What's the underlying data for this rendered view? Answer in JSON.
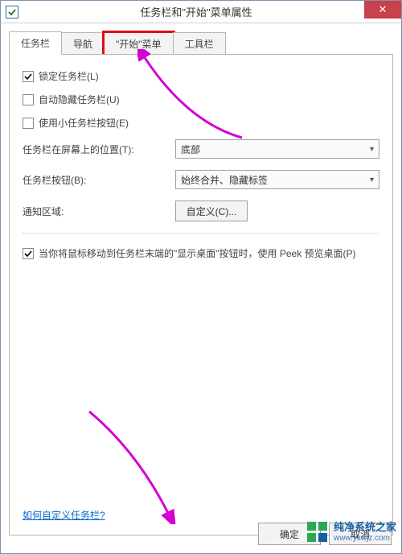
{
  "title": "任务栏和\"开始\"菜单属性",
  "tabs": [
    {
      "label": "任务栏",
      "active": true
    },
    {
      "label": "导航",
      "active": false
    },
    {
      "label": "\"开始\"菜单",
      "active": false,
      "highlight": true
    },
    {
      "label": "工具栏",
      "active": false
    }
  ],
  "checkboxes": {
    "lock": {
      "label": "锁定任务栏(L)",
      "checked": true
    },
    "autohide": {
      "label": "自动隐藏任务栏(U)",
      "checked": false
    },
    "smallbtn": {
      "label": "使用小任务栏按钮(E)",
      "checked": false
    }
  },
  "position": {
    "label": "任务栏在屏幕上的位置(T):",
    "value": "底部"
  },
  "buttons_combine": {
    "label": "任务栏按钮(B):",
    "value": "始终合并、隐藏标签"
  },
  "notify": {
    "label": "通知区域:",
    "button": "自定义(C)..."
  },
  "peek": {
    "checked": true,
    "label": "当你将鼠标移动到任务栏末端的\"显示桌面\"按钮时，使用 Peek 预览桌面(P)"
  },
  "help_link": "如何自定义任务栏?",
  "footer": {
    "ok": "确定",
    "cancel": "取消"
  },
  "watermark": {
    "name": "纯净系统之家",
    "url": "www.ycwjz.com"
  }
}
